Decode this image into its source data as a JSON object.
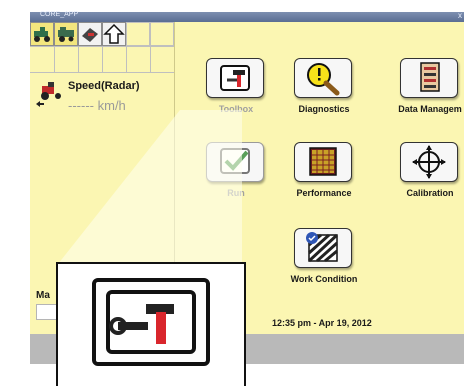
{
  "window": {
    "title": "CORE_APP",
    "close_glyph": "x"
  },
  "left_panel": {
    "toolbar_icons": [
      "tractor-icon",
      "harvester-icon",
      "implement-icon",
      "up-arrow-icon"
    ],
    "speed": {
      "label": "Speed(Radar)",
      "value": "------",
      "unit": "km/h"
    },
    "bottom_label": "Ma"
  },
  "apps": [
    {
      "label": "Toolbox",
      "icon": "toolbox-icon",
      "enabled": false
    },
    {
      "label": "Diagnostics",
      "icon": "magnifier-icon",
      "enabled": true
    },
    {
      "label": "Data Managem",
      "icon": "data-management-icon",
      "enabled": true
    },
    {
      "label": "Run",
      "icon": "checkmark-icon",
      "enabled": false
    },
    {
      "label": "Performance",
      "icon": "performance-grid-icon",
      "enabled": true
    },
    {
      "label": "Calibration",
      "icon": "crosshair-icon",
      "enabled": true
    },
    {
      "label": "Work Condition",
      "icon": "work-condition-icon",
      "enabled": true
    }
  ],
  "status": {
    "datetime": "12:35 pm - Apr 19, 2012"
  },
  "colors": {
    "screen_bg": "#fbf6b2",
    "titlebar": "#5a6d92",
    "red_accent": "#d9262c"
  }
}
